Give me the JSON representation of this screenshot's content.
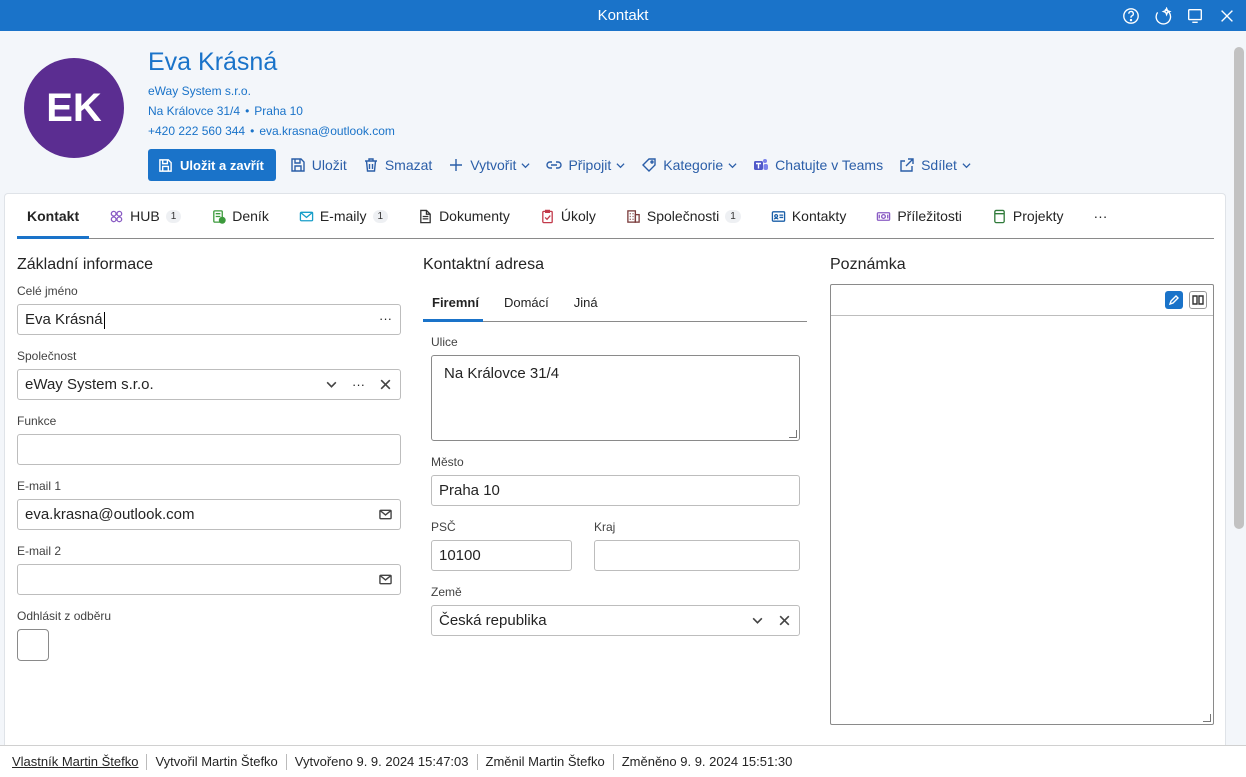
{
  "window": {
    "title": "Kontakt"
  },
  "contact": {
    "initials": "EK",
    "name": "Eva Krásná",
    "company": "eWay System s.r.o.",
    "street": "Na Královce 31/4",
    "city": "Praha 10",
    "phone": "+420 222 560 344",
    "email": "eva.krasna@outlook.com"
  },
  "toolbar": {
    "save_close": "Uložit a zavřít",
    "save": "Uložit",
    "delete": "Smazat",
    "create": "Vytvořit",
    "connect": "Připojit",
    "category": "Kategorie",
    "teams": "Chatujte v Teams",
    "share": "Sdílet"
  },
  "tabs": [
    {
      "label": "Kontakt"
    },
    {
      "label": "HUB",
      "badge": "1"
    },
    {
      "label": "Deník"
    },
    {
      "label": "E-maily",
      "badge": "1"
    },
    {
      "label": "Dokumenty"
    },
    {
      "label": "Úkoly"
    },
    {
      "label": "Společnosti",
      "badge": "1"
    },
    {
      "label": "Kontakty"
    },
    {
      "label": "Příležitosti"
    },
    {
      "label": "Projekty"
    },
    {
      "label": "···"
    }
  ],
  "basic": {
    "title": "Základní informace",
    "fullname_label": "Celé jméno",
    "fullname_value": "Eva Krásná",
    "company_label": "Společnost",
    "company_value": "eWay System s.r.o.",
    "function_label": "Funkce",
    "function_value": "",
    "email1_label": "E-mail 1",
    "email1_value": "eva.krasna@outlook.com",
    "email2_label": "E-mail 2",
    "email2_value": "",
    "unsubscribe_label": "Odhlásit z odběru"
  },
  "address": {
    "title": "Kontaktní adresa",
    "subtabs": [
      "Firemní",
      "Domácí",
      "Jiná"
    ],
    "street_label": "Ulice",
    "street_value": "Na Královce 31/4",
    "city_label": "Město",
    "city_value": "Praha 10",
    "zip_label": "PSČ",
    "zip_value": "10100",
    "region_label": "Kraj",
    "region_value": "",
    "country_label": "Země",
    "country_value": "Česká republika"
  },
  "note": {
    "title": "Poznámka"
  },
  "status": {
    "owner": "Vlastník Martin Štefko",
    "created_by": "Vytvořil Martin Štefko",
    "created": "Vytvořeno 9. 9. 2024 15:47:03",
    "changed_by": "Změnil Martin Štefko",
    "changed": "Změněno 9. 9. 2024 15:51:30"
  },
  "colors": {
    "accent": "#1a73c9",
    "avatar": "#5b2d91"
  }
}
